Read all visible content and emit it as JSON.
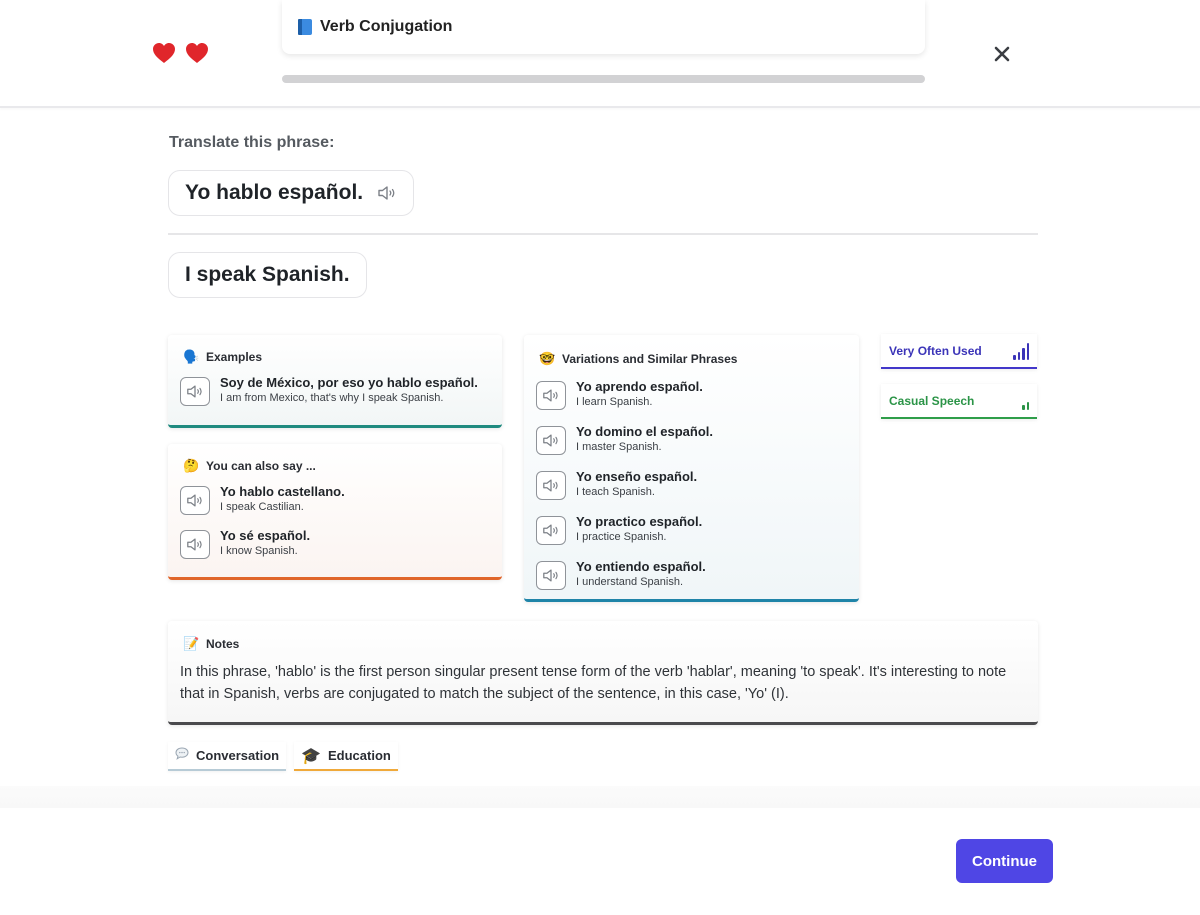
{
  "header": {
    "lives": 2,
    "heart_color": "#e0262b",
    "topic_icon": "book-icon",
    "topic_title": "Verb Conjugation",
    "progress_fraction": 0.0,
    "close_icon": "close-icon"
  },
  "prompt": {
    "label": "Translate this phrase:",
    "phrase": "Yo hablo español.",
    "phrase_audio_icon": "speaker-icon",
    "answer": "I speak Spanish."
  },
  "examples": {
    "icon": "speaking-head-icon",
    "title": "Examples",
    "accent": "#1f8a7f",
    "items": [
      {
        "es": "Soy de México, por eso yo hablo español.",
        "en": "I am from Mexico, that's why I speak Spanish."
      }
    ]
  },
  "also_say": {
    "icon": "thinking-face-icon",
    "title": "You can also say ...",
    "accent": "#e0652a",
    "items": [
      {
        "es": "Yo hablo castellano.",
        "en": "I speak Castilian."
      },
      {
        "es": "Yo sé español.",
        "en": "I know Spanish."
      }
    ]
  },
  "variations": {
    "icon": "nerd-face-icon",
    "title": "Variations and Similar Phrases",
    "accent": "#1f84a8",
    "items": [
      {
        "es": "Yo aprendo español.",
        "en": "I learn Spanish."
      },
      {
        "es": "Yo domino el español.",
        "en": "I master Spanish."
      },
      {
        "es": "Yo enseño español.",
        "en": "I teach Spanish."
      },
      {
        "es": "Yo practico español.",
        "en": "I practice Spanish."
      },
      {
        "es": "Yo entiendo español.",
        "en": "I understand Spanish."
      }
    ]
  },
  "tags": [
    {
      "label": "Very Often Used",
      "color": "#3b34b8",
      "level": 4,
      "max": 4
    },
    {
      "label": "Casual Speech",
      "color": "#2b9447",
      "level": 2,
      "max": 4
    }
  ],
  "notes": {
    "icon": "memo-icon",
    "title": "Notes",
    "text": "In this phrase, 'hablo' is the first person singular present tense form of the verb 'hablar', meaning 'to speak'. It's interesting to note that in Spanish, verbs are conjugated to match the subject of the sentence, in this case, 'Yo' (I)."
  },
  "chips": [
    {
      "icon": "speech-bubble-icon",
      "label": "Conversation"
    },
    {
      "icon": "graduation-cap-icon",
      "label": "Education"
    }
  ],
  "footer": {
    "continue_label": "Continue",
    "continue_color": "#4f46e5"
  }
}
